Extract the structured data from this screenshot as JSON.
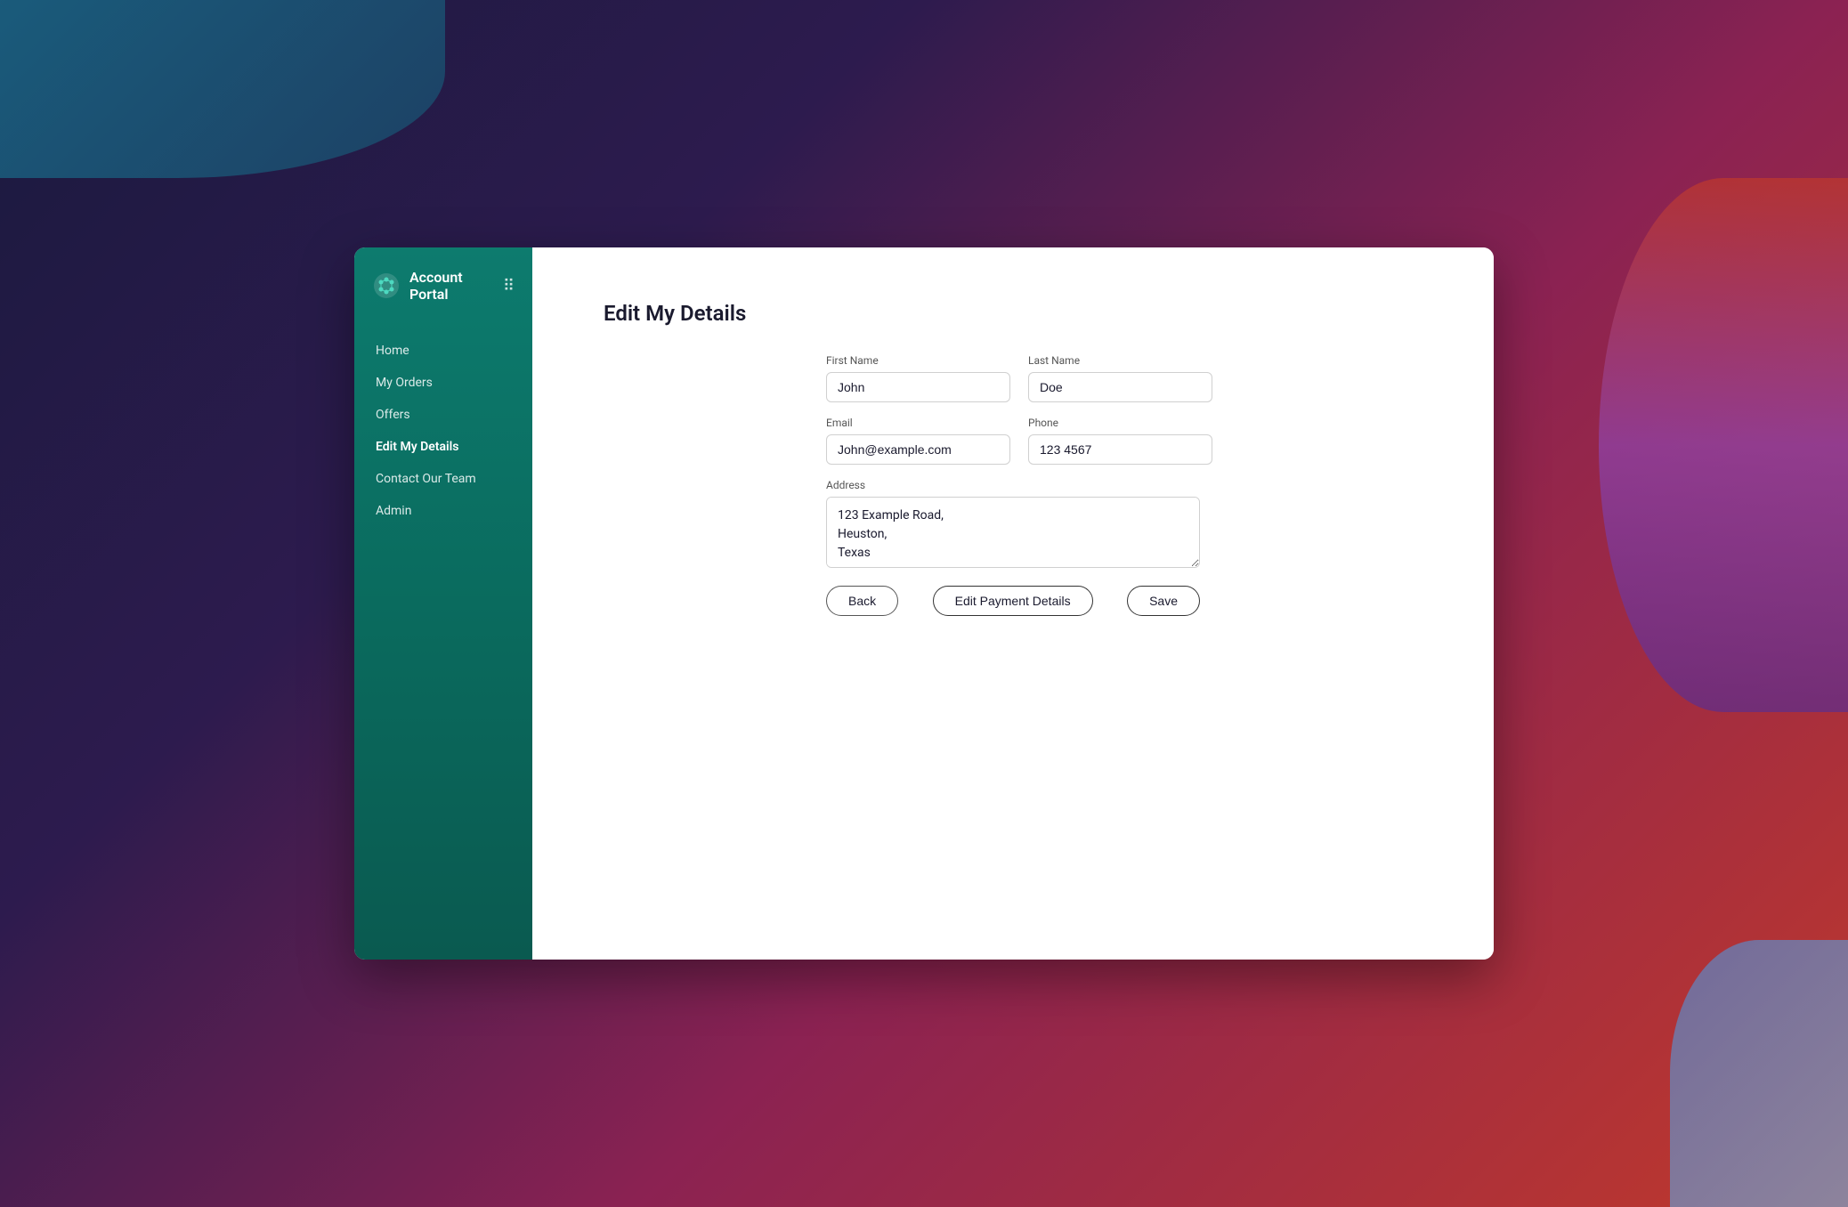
{
  "app": {
    "title": "Account Portal",
    "grid_icon": "⠿"
  },
  "sidebar": {
    "nav_items": [
      {
        "id": "home",
        "label": "Home",
        "active": false
      },
      {
        "id": "my-orders",
        "label": "My Orders",
        "active": false
      },
      {
        "id": "offers",
        "label": "Offers",
        "active": false
      },
      {
        "id": "edit-my-details",
        "label": "Edit My Details",
        "active": true
      },
      {
        "id": "contact-our-team",
        "label": "Contact Our Team",
        "active": false
      },
      {
        "id": "admin",
        "label": "Admin",
        "active": false
      }
    ]
  },
  "main": {
    "page_title": "Edit My Details",
    "form": {
      "first_name_label": "First Name",
      "first_name_value": "John",
      "last_name_label": "Last Name",
      "last_name_value": "Doe",
      "email_label": "Email",
      "email_value": "John@example.com",
      "phone_label": "Phone",
      "phone_value": "123 4567",
      "address_label": "Address",
      "address_value": "123 Example Road,\nHeuston,\nTexas"
    },
    "buttons": {
      "back": "Back",
      "edit_payment": "Edit Payment Details",
      "save": "Save"
    }
  }
}
